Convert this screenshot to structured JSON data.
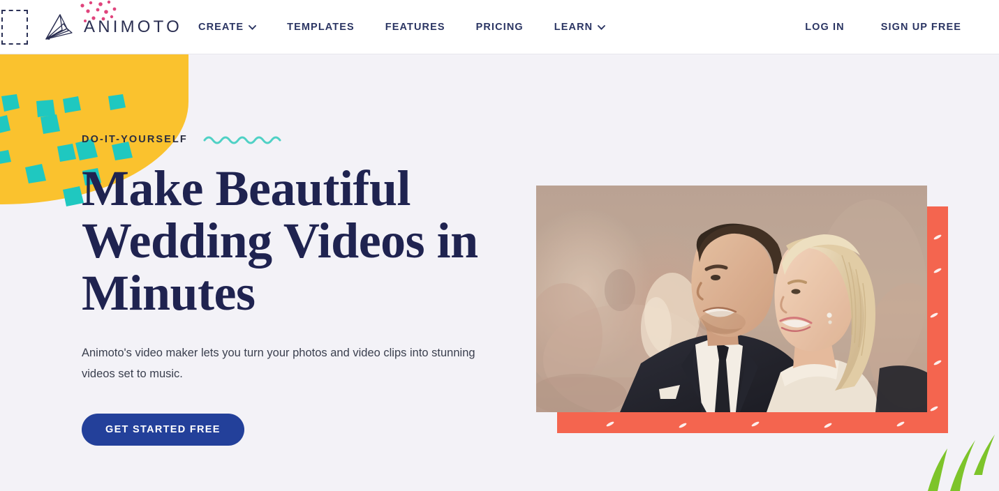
{
  "colors": {
    "page_background": "#f3f2f7",
    "header_background": "#ffffff",
    "nav_text": "#2b3563",
    "brand_text": "#2b2f52",
    "headline": "#1f2350",
    "cta_background": "#23409a",
    "cta_text": "#ffffff",
    "accent_yellow": "#fac22e",
    "accent_teal": "#1fc8c0",
    "accent_coral": "#f4654f",
    "accent_pink": "#e0447c",
    "accent_green": "#7dc42a",
    "accent_mint": "#cfe4da",
    "squiggle": "#4fd1c5"
  },
  "header": {
    "brand": {
      "name": "ANIMOTO",
      "logo_icon": "animoto-wing-logo",
      "dots_icon": "pink-dots-decoration"
    },
    "nav": [
      {
        "label": "CREATE",
        "has_dropdown": true,
        "icon": "chevron-down-icon"
      },
      {
        "label": "TEMPLATES",
        "has_dropdown": false,
        "icon": ""
      },
      {
        "label": "FEATURES",
        "has_dropdown": false,
        "icon": ""
      },
      {
        "label": "PRICING",
        "has_dropdown": false,
        "icon": ""
      },
      {
        "label": "LEARN",
        "has_dropdown": true,
        "icon": "chevron-down-icon"
      }
    ],
    "auth": [
      {
        "label": "LOG IN"
      },
      {
        "label": "SIGN UP FREE"
      }
    ]
  },
  "hero": {
    "eyebrow": "DO-IT-YOURSELF",
    "squiggle_icon": "wavy-line-decoration",
    "headline": "Make Beautiful Wedding Videos in Minutes",
    "subheadline": "Animoto's video maker lets you turn your photos and video clips into stunning videos set to music.",
    "cta_label": "GET STARTED FREE",
    "image_alt": "wedding-couple-photo"
  },
  "decor": {
    "yellow_blob": "yellow-blob-shape",
    "teal_confetti": "teal-confetti-shapes",
    "mint_circle": "mint-circle-shape",
    "coral_block": "coral-patterned-block",
    "green_blades": "green-leaf-blades",
    "placeholder_box": "dashed-placeholder-box"
  }
}
